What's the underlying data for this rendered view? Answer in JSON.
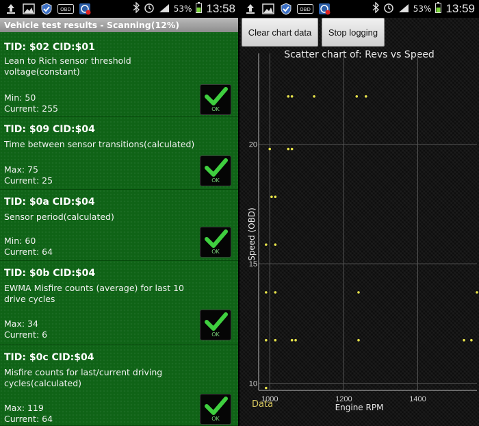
{
  "status_left": {
    "time": "13:58",
    "battery": "53%"
  },
  "status_right": {
    "time": "13:59",
    "battery": "53%"
  },
  "status_icons": [
    "upload-icon",
    "image-icon",
    "shield-icon",
    "obd-icon",
    "app-icon",
    "bluetooth-icon",
    "alarm-icon",
    "signal-icon",
    "battery-icon"
  ],
  "obd_icon_text": "OBD",
  "left_title": "Vehicle test results - Scanning(12%)",
  "tests": [
    {
      "title": "TID: $02 CID:$01",
      "desc": "Lean to Rich sensor threshold voltage(constant)",
      "limit_label": "Min: 50",
      "current": "Current: 255",
      "ok": "OK"
    },
    {
      "title": "TID: $09 CID:$04",
      "desc": "Time between sensor transitions(calculated)",
      "limit_label": "Max: 75",
      "current": "Current: 25",
      "ok": "OK"
    },
    {
      "title": "TID: $0a CID:$04",
      "desc": "Sensor period(calculated)",
      "limit_label": "Min: 60",
      "current": "Current: 64",
      "ok": "OK"
    },
    {
      "title": "TID: $0b CID:$04",
      "desc": "EWMA Misfire counts (average) for last 10 drive cycles",
      "limit_label": "Max: 34",
      "current": "Current: 6",
      "ok": "OK"
    },
    {
      "title": "TID: $0c CID:$04",
      "desc": "Misfire counts for last/current driving cycles(calculated)",
      "limit_label": "Max: 119",
      "current": "Current: 64",
      "ok": "OK"
    }
  ],
  "buttons": {
    "clear": "Clear chart data",
    "stop": "Stop logging"
  },
  "colors": {
    "list_bg": "#0f6316",
    "point": "#e6e24a",
    "legend": "#d8c860"
  },
  "chart_data": {
    "type": "scatter",
    "title": "Scatter chart of: Revs vs Speed",
    "xlabel": "Engine RPM",
    "ylabel": "Speed (OBD)",
    "x_ticks": [
      "1000",
      "1200",
      "1400"
    ],
    "y_ticks": [
      "10",
      "15",
      "20"
    ],
    "xlim": [
      970,
      1560
    ],
    "ylim": [
      9.7,
      23.8
    ],
    "grid": true,
    "legend": [
      "Data"
    ],
    "legend_position": "bottom-left",
    "series": [
      {
        "name": "Data",
        "points": [
          [
            1050,
            22
          ],
          [
            1060,
            22
          ],
          [
            1120,
            22
          ],
          [
            1235,
            22
          ],
          [
            1260,
            22
          ],
          [
            1000,
            19.8
          ],
          [
            1050,
            19.8
          ],
          [
            1060,
            19.8
          ],
          [
            1005,
            17.8
          ],
          [
            1015,
            17.8
          ],
          [
            990,
            15.8
          ],
          [
            1015,
            15.8
          ],
          [
            990,
            13.8
          ],
          [
            1015,
            13.8
          ],
          [
            1240,
            13.8
          ],
          [
            1560,
            13.8
          ],
          [
            990,
            11.8
          ],
          [
            1015,
            11.8
          ],
          [
            1060,
            11.8
          ],
          [
            1070,
            11.8
          ],
          [
            1240,
            11.8
          ],
          [
            1525,
            11.8
          ],
          [
            1545,
            11.8
          ],
          [
            990,
            9.8
          ]
        ]
      }
    ]
  }
}
